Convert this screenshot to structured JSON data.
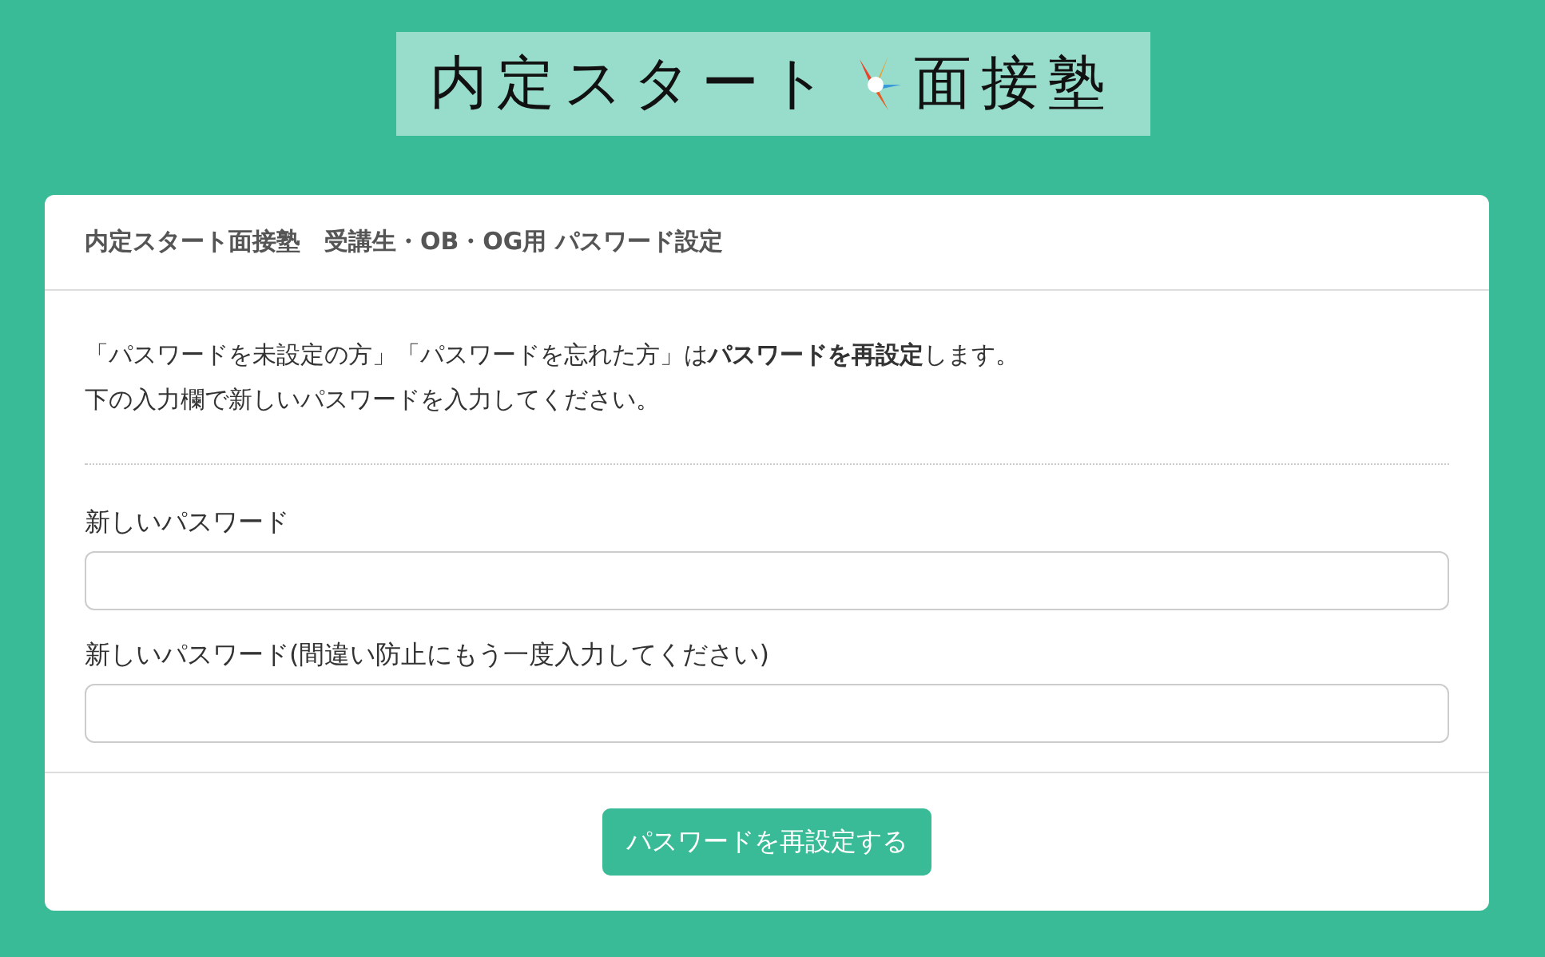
{
  "logo": {
    "text_before": "内定スタート",
    "text_after": "面接塾"
  },
  "card": {
    "title": "内定スタート面接塾　受講生・OB・OG用 パスワード設定",
    "intro": [
      "「パスワードを未設定の方」「パスワードを忘れた方」は**パスワードを再設定**します。",
      "下の入力欄で新しいパスワードを入力してください。"
    ],
    "fields": [
      {
        "label": "新しいパスワード"
      },
      {
        "label": "新しいパスワード(間違い防止にもう一度入力してください)"
      }
    ],
    "submit": "パスワードを再設定する"
  }
}
